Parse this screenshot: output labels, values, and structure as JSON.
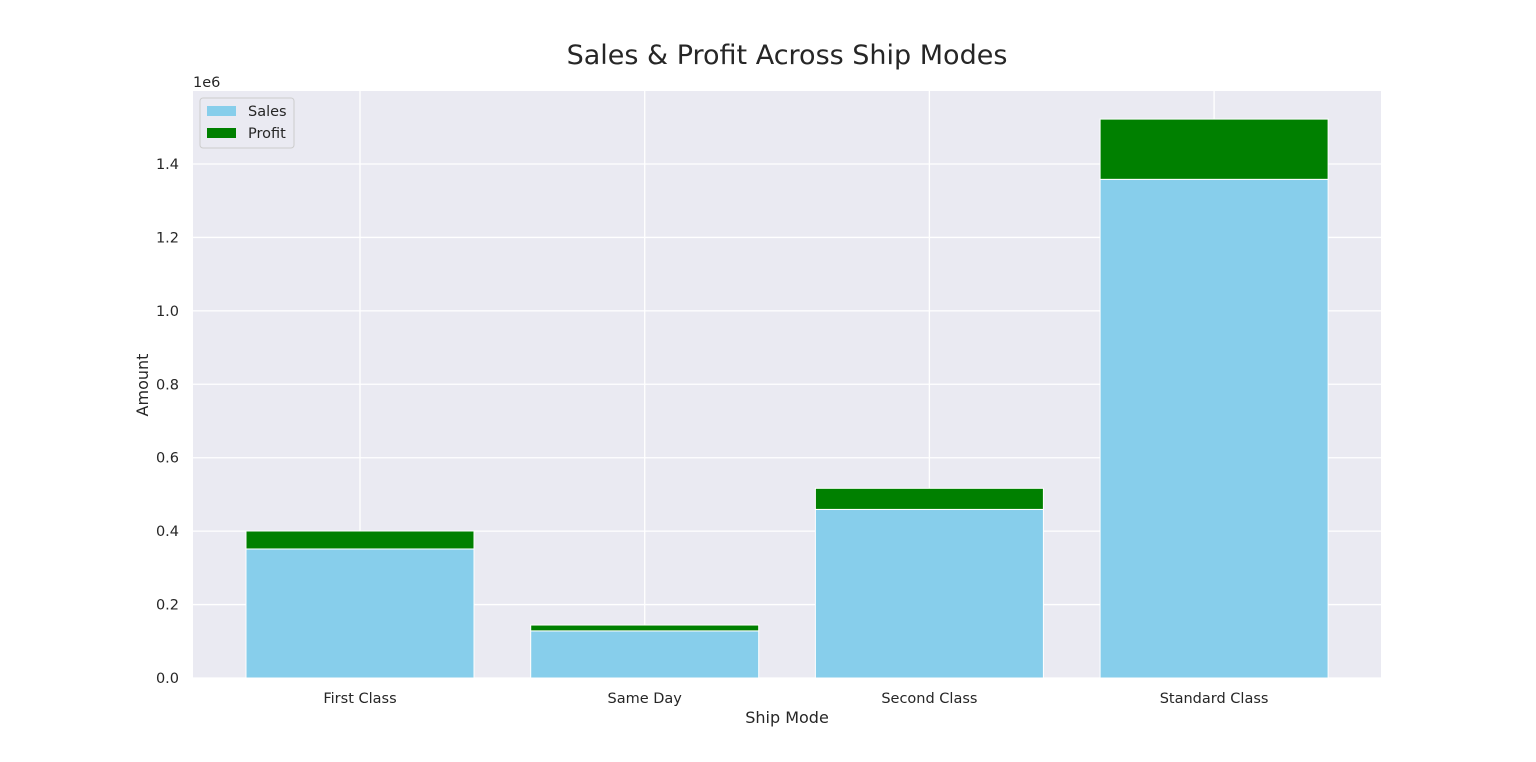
{
  "chart_data": {
    "type": "bar",
    "stacked": true,
    "title": "Sales & Profit Across Ship Modes",
    "xlabel": "Ship Mode",
    "ylabel": "Amount",
    "y_offset_label": "1e6",
    "categories": [
      "First Class",
      "Same Day",
      "Second Class",
      "Standard Class"
    ],
    "series": [
      {
        "name": "Sales",
        "color": "#87CEEB",
        "values": [
          351428,
          128363,
          459194,
          1358216
        ]
      },
      {
        "name": "Profit",
        "color": "#008000",
        "values": [
          48970,
          15892,
          57447,
          164089
        ]
      }
    ],
    "ylim": [
      0,
      1600000
    ],
    "yticks": [
      0,
      200000,
      400000,
      600000,
      800000,
      1000000,
      1200000,
      1400000
    ],
    "ytick_labels": [
      "0.0",
      "0.2",
      "0.4",
      "0.6",
      "0.8",
      "1.0",
      "1.2",
      "1.4"
    ],
    "grid": true,
    "legend_position": "top-left",
    "background_color": "#EAEAF2"
  }
}
